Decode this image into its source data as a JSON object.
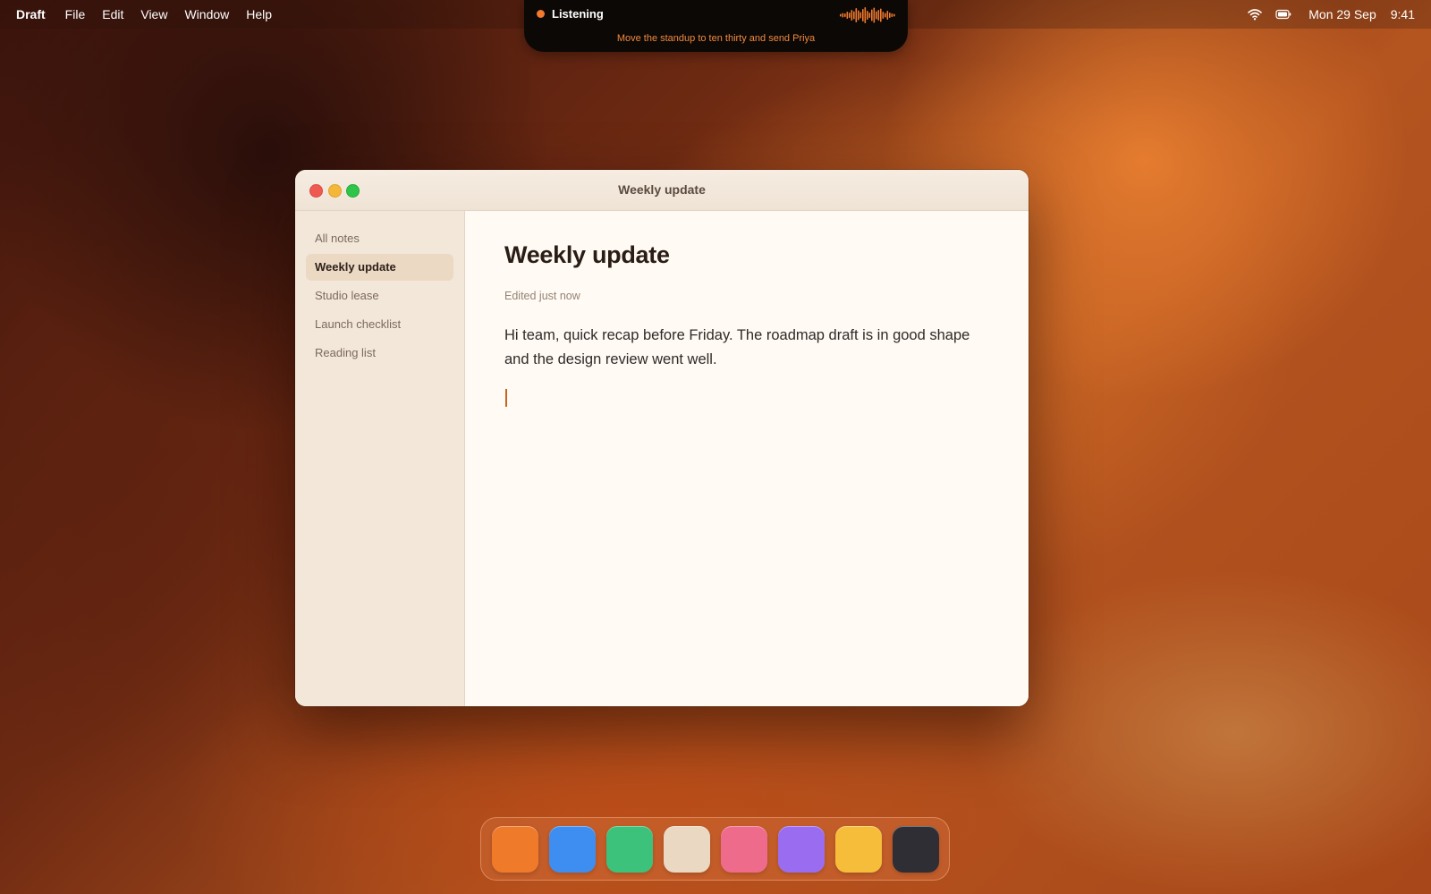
{
  "menubar": {
    "app_name": "Draft",
    "menus": [
      "File",
      "Edit",
      "View",
      "Window",
      "Help"
    ],
    "date": "Mon 29 Sep",
    "time": "9:41",
    "status_icons": [
      "wifi-icon",
      "battery-icon"
    ]
  },
  "listening": {
    "label": "Listening",
    "transcript": "Move the standup to ten thirty and send Priya",
    "accent_color": "#f27a2e"
  },
  "window": {
    "title": "Weekly update",
    "traffic_lights": [
      "close",
      "minimize",
      "zoom"
    ]
  },
  "sidebar": {
    "items": [
      {
        "label": "All notes",
        "active": false
      },
      {
        "label": "Weekly update",
        "active": true
      },
      {
        "label": "Studio lease",
        "active": false
      },
      {
        "label": "Launch checklist",
        "active": false
      },
      {
        "label": "Reading list",
        "active": false
      }
    ]
  },
  "editor": {
    "title": "Weekly update",
    "meta": "Edited just now",
    "body": "Hi team, quick recap before Friday. The roadmap draft is in good shape and the design review went well."
  },
  "dock": {
    "apps": [
      {
        "name": "orange-app-icon",
        "color": "#ef7a2a"
      },
      {
        "name": "blue-app-icon",
        "color": "#3d8ef0"
      },
      {
        "name": "green-app-icon",
        "color": "#3cc27a"
      },
      {
        "name": "cream-app-icon",
        "color": "#ead8c2"
      },
      {
        "name": "pink-app-icon",
        "color": "#ef6b8c"
      },
      {
        "name": "purple-app-icon",
        "color": "#9a6cf0"
      },
      {
        "name": "yellow-app-icon",
        "color": "#f5bd3a"
      },
      {
        "name": "dark-app-icon",
        "color": "#2e2e34"
      }
    ]
  }
}
